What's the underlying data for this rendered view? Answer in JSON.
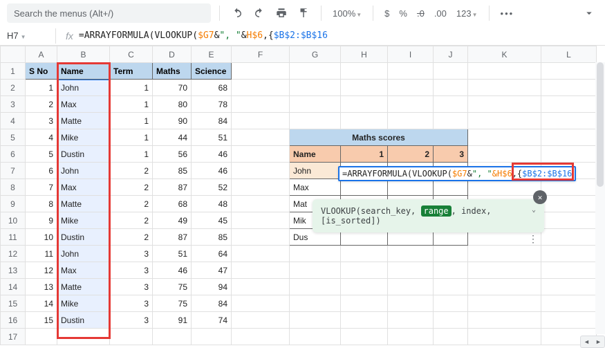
{
  "topbar": {
    "search_placeholder": "Search the menus (Alt+/)",
    "zoom": "100%",
    "currency": "$",
    "percent": "%",
    "dec_dec": ".0",
    "dec_inc": ".00",
    "format": "123"
  },
  "fbar": {
    "cellref": "H7",
    "formula_prefix": "=",
    "fn1": "ARRAYFORMULA",
    "fn2": "VLOOKUP",
    "arg_g": "$G7",
    "amp": "&",
    "comma_str": "\", \"",
    "arg_h": "H$6",
    "range": "$B$2:$B$16"
  },
  "headers": {
    "A": "S No",
    "B": "Name",
    "C": "Term",
    "D": "Maths",
    "E": "Science"
  },
  "rows": [
    {
      "a": "1",
      "b": "John",
      "c": "1",
      "d": "70",
      "e": "68"
    },
    {
      "a": "2",
      "b": "Max",
      "c": "1",
      "d": "80",
      "e": "78"
    },
    {
      "a": "3",
      "b": "Matte",
      "c": "1",
      "d": "90",
      "e": "84"
    },
    {
      "a": "4",
      "b": "Mike",
      "c": "1",
      "d": "44",
      "e": "51"
    },
    {
      "a": "5",
      "b": "Dustin",
      "c": "1",
      "d": "56",
      "e": "46"
    },
    {
      "a": "6",
      "b": "John",
      "c": "2",
      "d": "85",
      "e": "46"
    },
    {
      "a": "7",
      "b": "Max",
      "c": "2",
      "d": "87",
      "e": "52"
    },
    {
      "a": "8",
      "b": "Matte",
      "c": "2",
      "d": "68",
      "e": "48"
    },
    {
      "a": "9",
      "b": "Mike",
      "c": "2",
      "d": "49",
      "e": "45"
    },
    {
      "a": "10",
      "b": "Dustin",
      "c": "2",
      "d": "87",
      "e": "85"
    },
    {
      "a": "11",
      "b": "John",
      "c": "3",
      "d": "51",
      "e": "64"
    },
    {
      "a": "12",
      "b": "Max",
      "c": "3",
      "d": "46",
      "e": "47"
    },
    {
      "a": "13",
      "b": "Matte",
      "c": "3",
      "d": "75",
      "e": "94"
    },
    {
      "a": "14",
      "b": "Mike",
      "c": "3",
      "d": "75",
      "e": "84"
    },
    {
      "a": "15",
      "b": "Dustin",
      "c": "3",
      "d": "91",
      "e": "74"
    }
  ],
  "maths": {
    "title": "Maths scores",
    "name_h": "Name",
    "t1": "1",
    "t2": "2",
    "t3": "3",
    "names": [
      "John",
      "Max",
      "Mat",
      "Mik",
      "Dus"
    ],
    "names_short": {
      "r1": "John",
      "r2": "Max",
      "r3": "Mat",
      "r4": "Mik",
      "r5": "Dus"
    }
  },
  "inline_formula": {
    "p1": "=ARRAYFORMULA(",
    "p2": "VLOOKUP(",
    "arg_g": "$G7",
    "amp": "&",
    "comma": "\", \"",
    "arg_h": "&H$6",
    "sep": ",{",
    "range": "$B$2:$B$16"
  },
  "tooltip": {
    "fn": "VLOOKUP",
    "sig1": "(search_key, ",
    "range_word": "range",
    "sig2": ", index,",
    "sig3": "[is_sorted])"
  },
  "cols": [
    "A",
    "B",
    "C",
    "D",
    "E",
    "F",
    "G",
    "H",
    "I",
    "J",
    "K",
    "L"
  ]
}
